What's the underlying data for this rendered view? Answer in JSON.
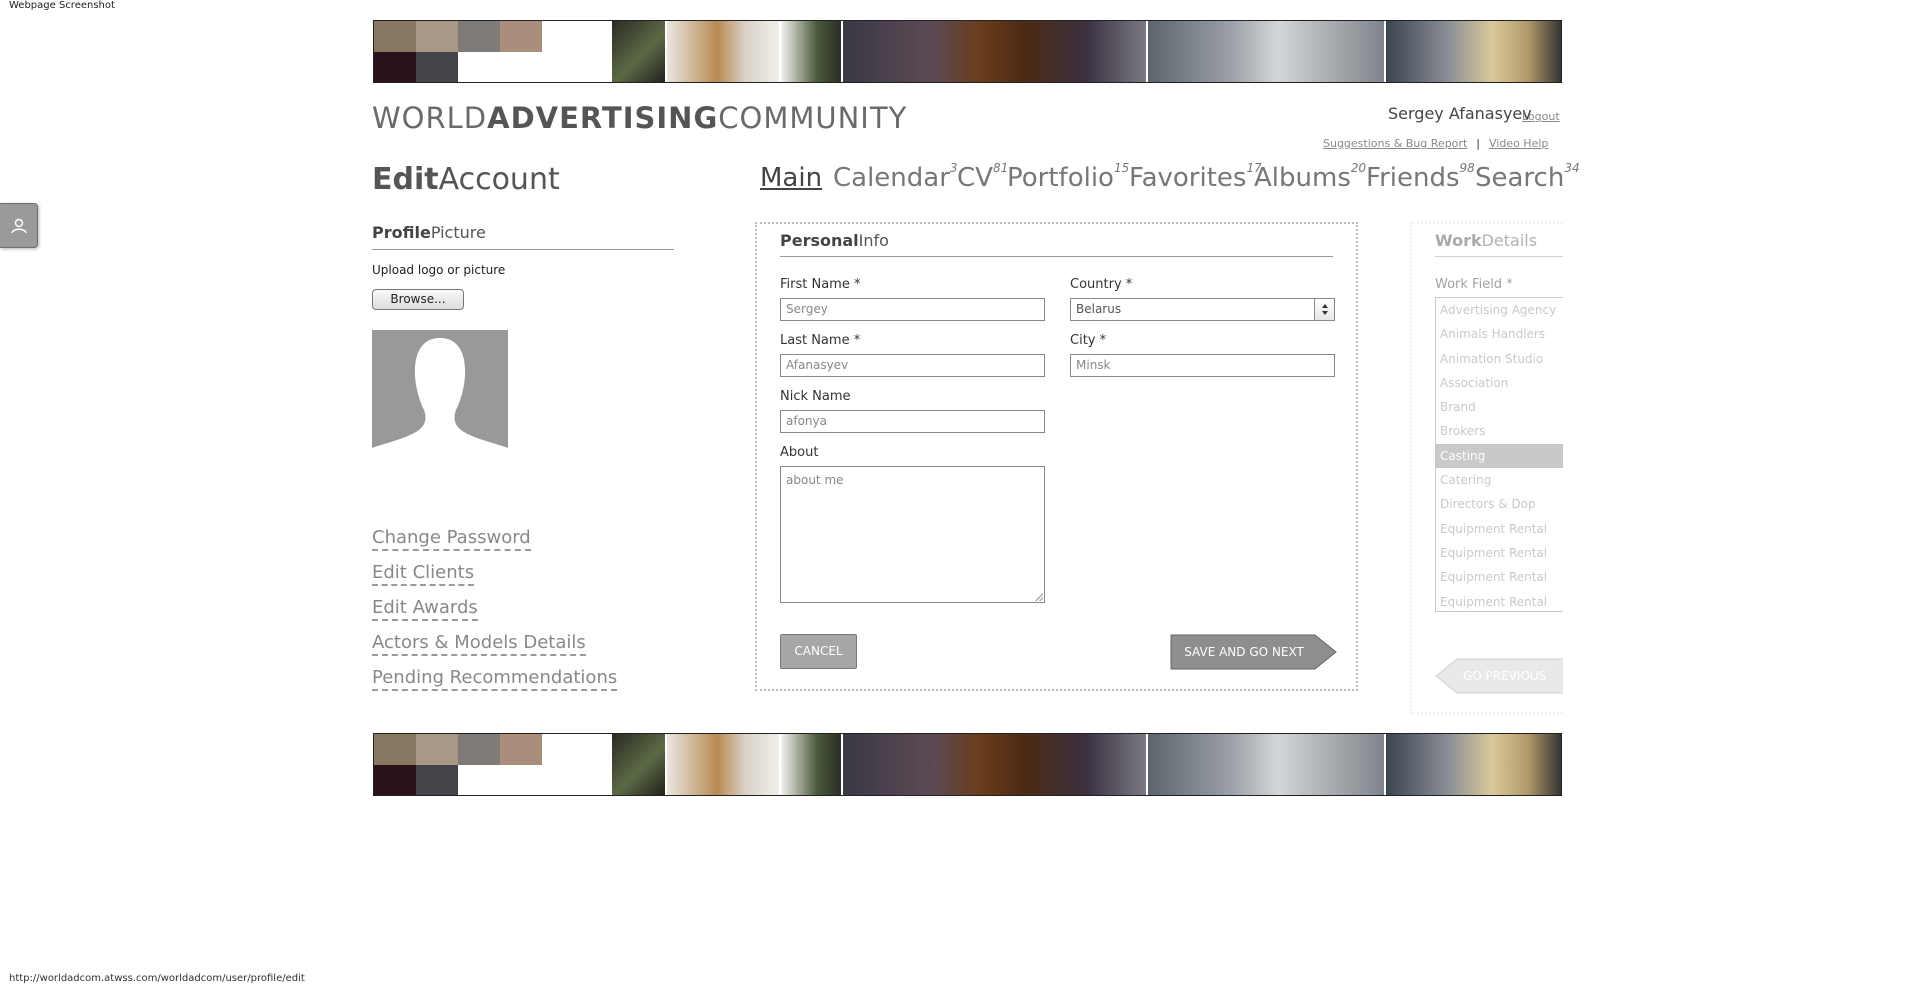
{
  "caption": "Webpage Screenshot",
  "status_url": "http://worldadcom.atwss.com/worldadcom/user/profile/edit",
  "colors": {
    "swatches": [
      "#877761",
      "#a89886",
      "#7e7a78",
      "#a88e7b",
      "#2a1018",
      "#45434a"
    ],
    "accent": "#555555",
    "button_gray": "#a6a6a6",
    "link_gray": "#888888"
  },
  "logo": {
    "part1": "WORLD",
    "part2": "ADVERTISING",
    "part3": "COMMUNITY"
  },
  "header": {
    "user_name": "Sergey Afanasyev",
    "logout": "Logout",
    "suggestions": "Suggestions & Bug Report",
    "separator": "|",
    "video_help": "Video Help"
  },
  "title": {
    "bold": "Edit",
    "normal": "Account"
  },
  "nav": [
    {
      "label": "Main",
      "count": ""
    },
    {
      "label": "Calendar",
      "count": "3"
    },
    {
      "label": "CV",
      "count": "81"
    },
    {
      "label": "Portfolio",
      "count": "15"
    },
    {
      "label": "Favorites",
      "count": "17"
    },
    {
      "label": "Albums",
      "count": "20"
    },
    {
      "label": "Friends",
      "count": "98"
    },
    {
      "label": "Search",
      "count": "34"
    }
  ],
  "profile": {
    "heading_bold": "Profile",
    "heading_normal": "Picture",
    "upload_label": "Upload logo or picture",
    "browse": "Browse..."
  },
  "side_links": [
    "Change Password",
    "Edit Clients",
    "Edit Awards",
    "Actors & Models Details",
    "Pending Recommendations"
  ],
  "personal": {
    "heading_bold": "Personal",
    "heading_normal": "Info",
    "first_name_label": "First Name *",
    "first_name": "Sergey",
    "last_name_label": "Last Name *",
    "last_name": "Afanasyev",
    "nick_label": "Nick Name",
    "nick": "afonya",
    "about_label": "About",
    "about": "about me",
    "country_label": "Country *",
    "country": "Belarus",
    "city_label": "City *",
    "city": "Minsk",
    "cancel": "CANCEL",
    "save": "SAVE AND GO NEXT"
  },
  "work": {
    "heading_bold": "Work",
    "heading_normal": "Details",
    "field_label": "Work Field *",
    "items": [
      "Advertising Agency",
      "Animals Handlers",
      "Animation Studio",
      "Association",
      "Brand",
      "Brokers",
      "Casting",
      "Catering",
      "Directors & Dop",
      "Equipment Rental",
      "Equipment Rental",
      "Equipment Rental",
      "Equipment Rental"
    ],
    "selected_index": 6,
    "prev": "GO PREVIOUS"
  }
}
